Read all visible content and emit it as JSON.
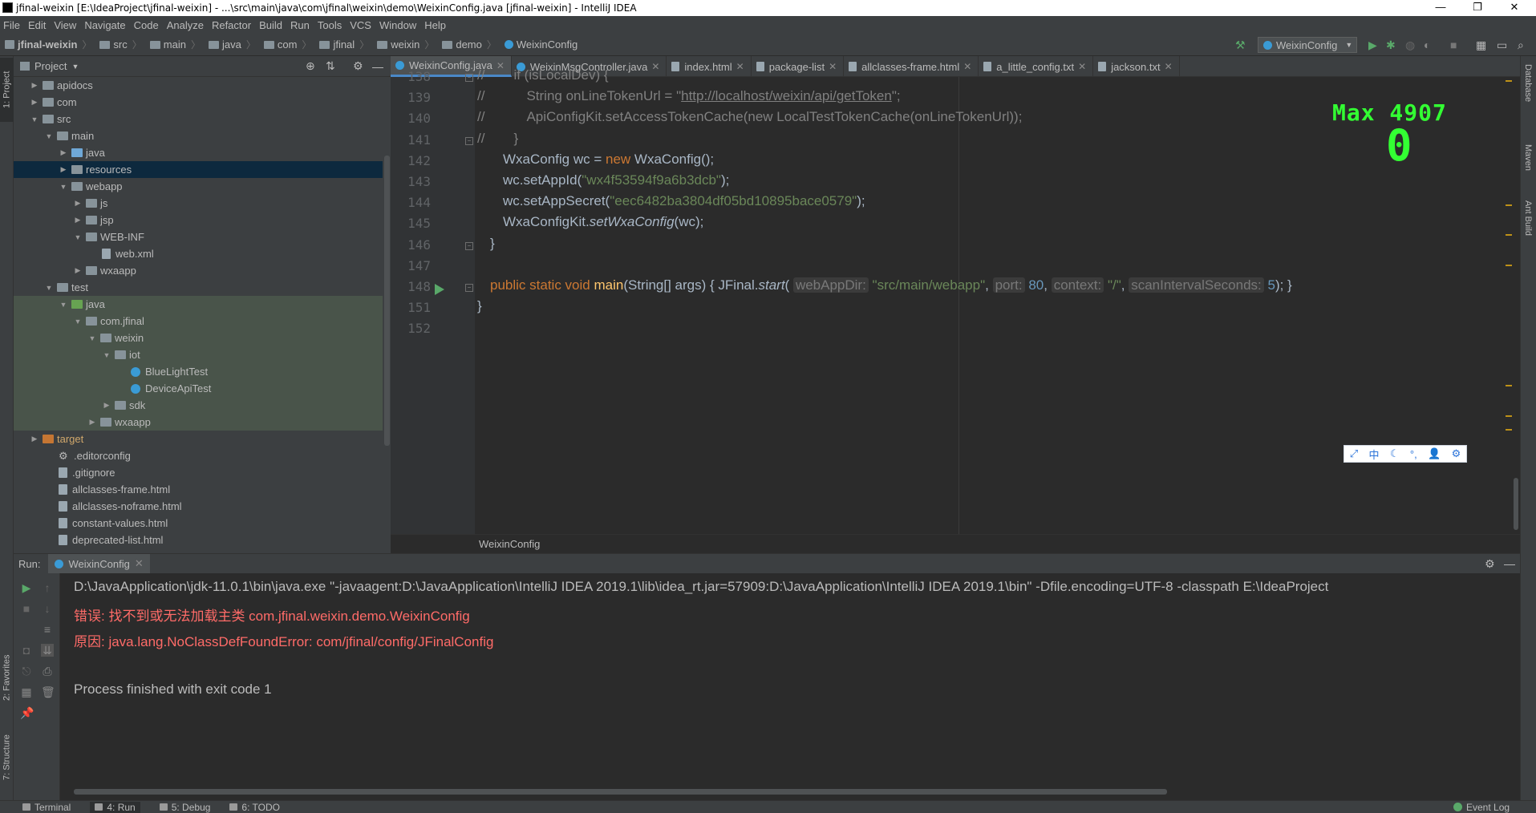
{
  "window": {
    "title": "jfinal-weixin [E:\\IdeaProject\\jfinal-weixin] - ...\\src\\main\\java\\com\\jfinal\\weixin\\demo\\WeixinConfig.java [jfinal-weixin] - IntelliJ IDEA",
    "minimize": "—",
    "restore": "❐",
    "close": "✕"
  },
  "menu": [
    "File",
    "Edit",
    "View",
    "Navigate",
    "Code",
    "Analyze",
    "Refactor",
    "Build",
    "Run",
    "Tools",
    "VCS",
    "Window",
    "Help"
  ],
  "breadcrumbs": [
    "jfinal-weixin",
    "src",
    "main",
    "java",
    "com",
    "jfinal",
    "weixin",
    "demo",
    "WeixinConfig"
  ],
  "run_config": "WeixinConfig",
  "project_panel": {
    "title": "Project"
  },
  "tree": [
    {
      "label": "apidocs",
      "depth": 0,
      "arrow": "▶",
      "icon": "gray"
    },
    {
      "label": "com",
      "depth": 0,
      "arrow": "▶",
      "icon": "gray"
    },
    {
      "label": "src",
      "depth": 0,
      "arrow": "▼",
      "icon": "gray"
    },
    {
      "label": "main",
      "depth": 1,
      "arrow": "▼",
      "icon": "gray"
    },
    {
      "label": "java",
      "depth": 2,
      "arrow": "▶",
      "icon": "blue"
    },
    {
      "label": "resources",
      "depth": 2,
      "arrow": "▶",
      "icon": "gray",
      "selected": true
    },
    {
      "label": "webapp",
      "depth": 2,
      "arrow": "▼",
      "icon": "gray"
    },
    {
      "label": "js",
      "depth": 3,
      "arrow": "▶",
      "icon": "gray"
    },
    {
      "label": "jsp",
      "depth": 3,
      "arrow": "▶",
      "icon": "gray"
    },
    {
      "label": "WEB-INF",
      "depth": 3,
      "arrow": "▼",
      "icon": "gray"
    },
    {
      "label": "web.xml",
      "depth": 4,
      "arrow": "",
      "icon": "file"
    },
    {
      "label": "wxaapp",
      "depth": 3,
      "arrow": "▶",
      "icon": "gray"
    },
    {
      "label": "test",
      "depth": 1,
      "arrow": "▼",
      "icon": "gray"
    },
    {
      "label": "java",
      "depth": 2,
      "arrow": "▼",
      "icon": "green",
      "test": true
    },
    {
      "label": "com.jfinal",
      "depth": 3,
      "arrow": "▼",
      "icon": "gray",
      "test": true
    },
    {
      "label": "weixin",
      "depth": 4,
      "arrow": "▼",
      "icon": "gray",
      "test": true
    },
    {
      "label": "iot",
      "depth": 5,
      "arrow": "▼",
      "icon": "gray",
      "test": true
    },
    {
      "label": "BlueLightTest",
      "depth": 6,
      "arrow": "",
      "icon": "cls",
      "test": true
    },
    {
      "label": "DeviceApiTest",
      "depth": 6,
      "arrow": "",
      "icon": "cls",
      "test": true
    },
    {
      "label": "sdk",
      "depth": 5,
      "arrow": "▶",
      "icon": "gray",
      "test": true
    },
    {
      "label": "wxaapp",
      "depth": 4,
      "arrow": "▶",
      "icon": "gray",
      "test": true
    },
    {
      "label": "target",
      "depth": 0,
      "arrow": "▶",
      "icon": "orange"
    },
    {
      "label": ".editorconfig",
      "depth": 1,
      "arrow": "",
      "icon": "gear"
    },
    {
      "label": ".gitignore",
      "depth": 1,
      "arrow": "",
      "icon": "file"
    },
    {
      "label": "allclasses-frame.html",
      "depth": 1,
      "arrow": "",
      "icon": "file"
    },
    {
      "label": "allclasses-noframe.html",
      "depth": 1,
      "arrow": "",
      "icon": "file"
    },
    {
      "label": "constant-values.html",
      "depth": 1,
      "arrow": "",
      "icon": "file"
    },
    {
      "label": "deprecated-list.html",
      "depth": 1,
      "arrow": "",
      "icon": "file"
    }
  ],
  "tabs": [
    {
      "label": "WeixinConfig.java",
      "icon": "cls",
      "active": true
    },
    {
      "label": "WeixinMsgController.java",
      "icon": "cls"
    },
    {
      "label": "index.html",
      "icon": "doc"
    },
    {
      "label": "package-list",
      "icon": "doc"
    },
    {
      "label": "allclasses-frame.html",
      "icon": "doc"
    },
    {
      "label": "a_little_config.txt",
      "icon": "doc"
    },
    {
      "label": "jackson.txt",
      "icon": "doc"
    }
  ],
  "line_numbers": [
    "138",
    "139",
    "140",
    "141",
    "142",
    "143",
    "144",
    "145",
    "146",
    "147",
    "148",
    "151",
    "152"
  ],
  "code": {
    "l138a": "//",
    "l138b": "if (isLocalDev) {",
    "l139a": "//",
    "l139b": "String onLineTokenUrl = \"",
    "l139c": "http://localhost/weixin/api/getToken",
    "l139d": "\";",
    "l140a": "//",
    "l140b": "ApiConfigKit.setAccessTokenCache(new LocalTestTokenCache(onLineTokenUrl));",
    "l141a": "//",
    "l141b": "}",
    "l142a": "WxaConfig wc = ",
    "l142b": "new",
    "l142c": " WxaConfig();",
    "l143a": "wc.setAppId(",
    "l143b": "\"wx4f53594f9a6b3dcb\"",
    "l143c": ");",
    "l144a": "wc.setAppSecret(",
    "l144b": "\"eec6482ba3804df05bd10895bace0579\"",
    "l144c": ");",
    "l145a": "WxaConfigKit.",
    "l145b": "setWxaConfig",
    "l145c": "(wc);",
    "l146": "}",
    "l148a": "public static void ",
    "l148b": "main",
    "l148c": "(String[] args) { JFinal.",
    "l148d": "start",
    "l148e": "( ",
    "l148h1": "webAppDir:",
    "l148s1": " \"src/main/webapp\"",
    "l148c1": ", ",
    "l148h2": "port:",
    "l148n2": " 80",
    "l148c2": ", ",
    "l148h3": "context:",
    "l148s3": " \"/\"",
    "l148c3": ", ",
    "l148h4": "scanIntervalSeconds:",
    "l148n4": " 5",
    "l148e2": "); }",
    "l151": "}"
  },
  "editor_breadcrumb": "WeixinConfig",
  "overlay": {
    "max_label": "Max 4907",
    "score": "0"
  },
  "ime": [
    "⤢",
    "中",
    "☾",
    "°,",
    "👤",
    "⚙"
  ],
  "run_panel": {
    "label": "Run:",
    "tab": "WeixinConfig"
  },
  "console": [
    {
      "text": "D:\\JavaApplication\\jdk-11.0.1\\bin\\java.exe \"-javaagent:D:\\JavaApplication\\IntelliJ IDEA 2019.1\\lib\\idea_rt.jar=57909:D:\\JavaApplication\\IntelliJ IDEA 2019.1\\bin\" -Dfile.encoding=UTF-8 -classpath E:\\IdeaProject",
      "err": false
    },
    {
      "text": "错误: 找不到或无法加载主类 com.jfinal.weixin.demo.WeixinConfig",
      "err": true
    },
    {
      "text": "原因: java.lang.NoClassDefFoundError: com/jfinal/config/JFinalConfig",
      "err": true
    },
    {
      "text": "",
      "err": false
    },
    {
      "text": "Process finished with exit code 1",
      "err": false
    }
  ],
  "left_tabs": [
    "1: Project",
    "2: Favorites",
    "7: Structure"
  ],
  "right_tabs": [
    "Database",
    "Maven",
    "Ant Build"
  ],
  "status": [
    {
      "label": "Terminal"
    },
    {
      "label": "4: Run",
      "active": true
    },
    {
      "label": "5: Debug"
    },
    {
      "label": "6: TODO"
    }
  ],
  "event_log": "Event Log"
}
